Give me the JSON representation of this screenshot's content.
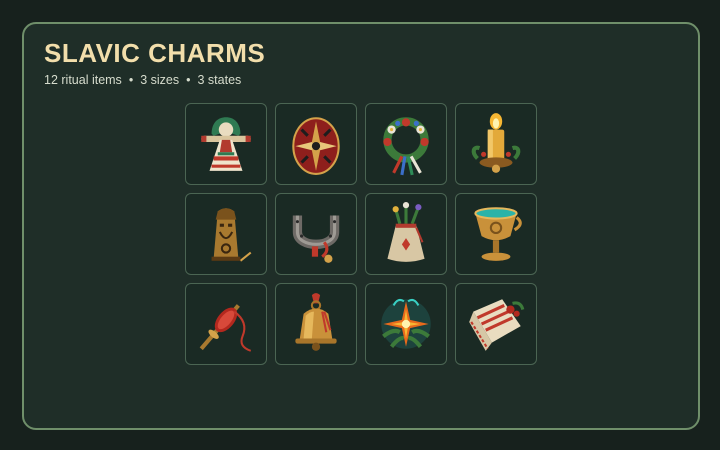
{
  "header": {
    "title": "SLAVIC CHARMS",
    "stats": [
      "12 ritual items",
      "3 sizes",
      "3 states"
    ],
    "separator": "•"
  },
  "colors": {
    "background": "#17211d",
    "panel": "#1f2e28",
    "panel_border": "#6f8f6a",
    "title": "#f2deab",
    "subtitle": "#d6dccd",
    "slot_border": "#4b6553"
  },
  "items": [
    {
      "icon": "motanka-doll-icon"
    },
    {
      "icon": "pysanka-egg-icon"
    },
    {
      "icon": "flower-wreath-icon"
    },
    {
      "icon": "candle-icon"
    },
    {
      "icon": "carved-idol-icon"
    },
    {
      "icon": "horseshoe-icon"
    },
    {
      "icon": "herb-pouch-icon"
    },
    {
      "icon": "golden-chalice-icon"
    },
    {
      "icon": "spindle-icon"
    },
    {
      "icon": "bell-icon"
    },
    {
      "icon": "fern-flower-icon"
    },
    {
      "icon": "embroidered-towel-icon"
    }
  ]
}
